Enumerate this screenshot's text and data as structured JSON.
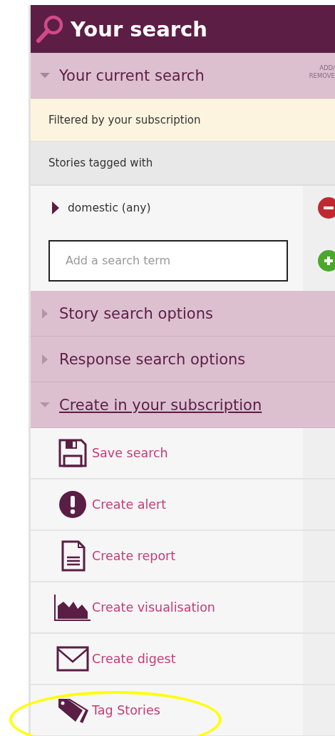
{
  "header": {
    "title": "Your search"
  },
  "current_search": {
    "label": "Your current search",
    "expanded": true,
    "action": "ADD/ REMOVE"
  },
  "filter_note": "Filtered by your subscription",
  "tagged_label": "Stories tagged with",
  "terms": [
    {
      "label": "domestic (any)"
    }
  ],
  "term_input": {
    "placeholder": "Add a search term"
  },
  "sections": [
    {
      "label": "Story search options",
      "expanded": false,
      "underlined": false
    },
    {
      "label": "Response search options",
      "expanded": false,
      "underlined": false
    },
    {
      "label": "Create in your subscription",
      "expanded": true,
      "underlined": true
    }
  ],
  "actions": [
    {
      "kind": "save",
      "label": "Save search",
      "highlighted": false
    },
    {
      "kind": "alert",
      "label": "Create alert",
      "highlighted": false
    },
    {
      "kind": "report",
      "label": "Create report",
      "highlighted": false
    },
    {
      "kind": "visualisation",
      "label": "Create visualisation",
      "highlighted": false
    },
    {
      "kind": "digest",
      "label": "Create digest",
      "highlighted": false
    },
    {
      "kind": "tag",
      "label": "Tag Stories",
      "highlighted": true
    }
  ]
}
